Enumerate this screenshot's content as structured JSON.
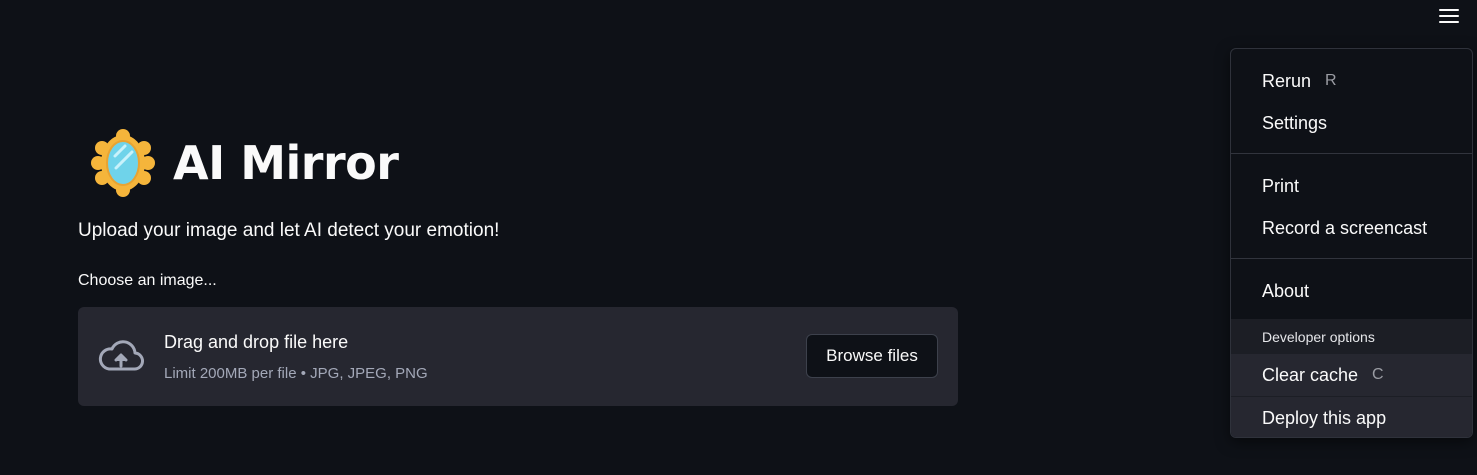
{
  "header": {
    "menu_icon": "hamburger-icon"
  },
  "main": {
    "title_icon": "mirror-icon",
    "title": "AI Mirror",
    "subtitle": "Upload your image and let AI detect your emotion!",
    "uploader": {
      "label": "Choose an image...",
      "icon": "cloud-upload-icon",
      "drop_text": "Drag and drop file here",
      "limit_text": "Limit 200MB per file • JPG, JPEG, PNG",
      "browse_label": "Browse files"
    }
  },
  "menu": {
    "items": [
      {
        "label": "Rerun",
        "shortcut": "R"
      },
      {
        "label": "Settings"
      },
      {
        "label": "Print"
      },
      {
        "label": "Record a screencast"
      },
      {
        "label": "About"
      }
    ],
    "developer": {
      "header": "Developer options",
      "items": [
        {
          "label": "Clear cache",
          "shortcut": "C"
        },
        {
          "label": "Deploy this app"
        }
      ]
    }
  },
  "colors": {
    "background": "#0e1117",
    "dropzone": "#262730",
    "text": "#fafafa",
    "muted": "#a3a8b8"
  }
}
